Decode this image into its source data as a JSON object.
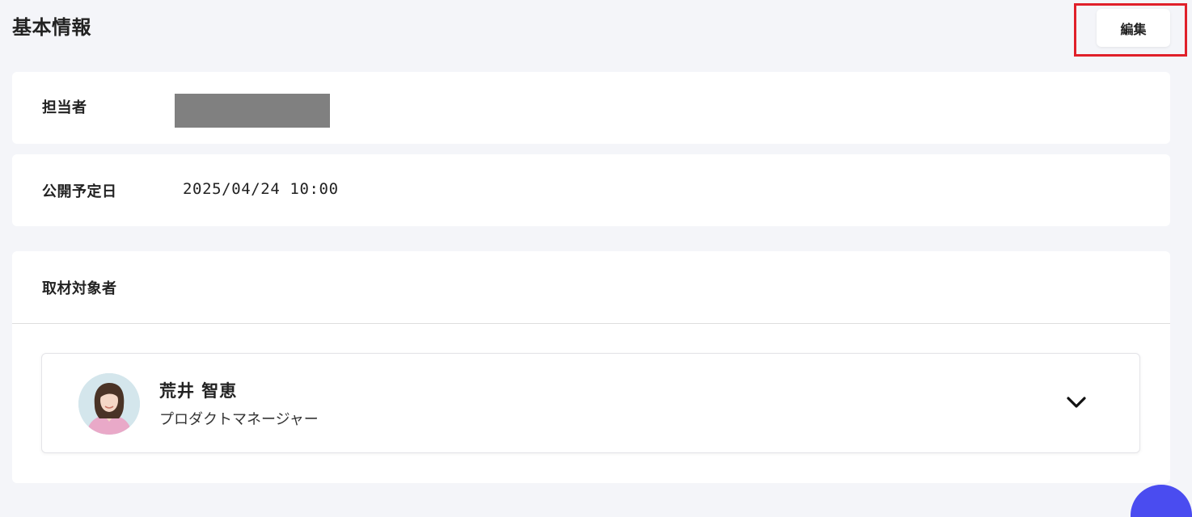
{
  "header": {
    "title": "基本情報",
    "edit_label": "編集"
  },
  "fields": {
    "assignee_label": "担当者",
    "publish_date_label": "公開予定日",
    "publish_date_value": "2025/04/24 10:00",
    "interviewee_label": "取材対象者"
  },
  "interviewee": {
    "name": "荒井 智恵",
    "role": "プロダクトマネージャー",
    "avatar_icon": "person-photo",
    "expand_icon": "chevron-down-icon"
  },
  "colors": {
    "background": "#f4f5f9",
    "highlight": "#e0202a",
    "floating_button": "#4a4cf0"
  }
}
